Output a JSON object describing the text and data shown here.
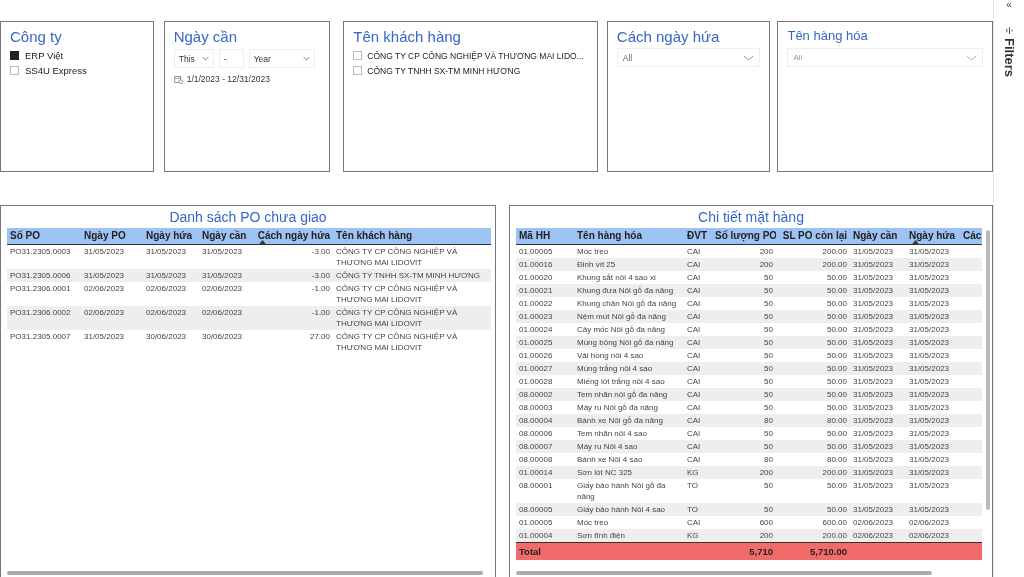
{
  "slicers": {
    "company": {
      "title": "Công ty",
      "items": [
        {
          "label": "ERP Việt",
          "selected": true
        },
        {
          "label": "SS4U Express",
          "selected": false
        }
      ]
    },
    "date": {
      "title": "Ngày cần",
      "relative": "This",
      "count": "-",
      "unit": "Year",
      "range": "1/1/2023 - 12/31/2023"
    },
    "customer": {
      "title": "Tên khách hàng",
      "items": [
        {
          "label": "CÔNG TY CP CÔNG NGHIỆP VÀ THƯƠNG MAI LIDO...",
          "checked": false
        },
        {
          "label": "CÔNG TY TNHH SX-TM MINH HƯƠNG",
          "checked": false
        }
      ]
    },
    "promise_gap": {
      "title": "Cách ngày hứa",
      "dropdown": "All"
    },
    "product": {
      "title": "Tên hàng hóa",
      "dropdown": "All"
    }
  },
  "po_table": {
    "title": "Danh sách PO chưa giao",
    "columns": [
      {
        "label": "Số PO",
        "sorted": false
      },
      {
        "label": "Ngày PO",
        "sorted": false
      },
      {
        "label": "Ngày hứa",
        "sorted": false
      },
      {
        "label": "Ngày cần",
        "sorted": false
      },
      {
        "label": "Cách ngày hứa",
        "sorted": true
      },
      {
        "label": "Tên khách hàng",
        "sorted": false
      }
    ],
    "rows": [
      [
        "PO31.2305.0003",
        "31/05/2023",
        "31/05/2023",
        "31/05/2023",
        "-3.00",
        "CÔNG TY CP CÔNG NGHIỆP VÀ THƯƠNG MAI LIDOVIT"
      ],
      [
        "PO31.2305.0006",
        "31/05/2023",
        "31/05/2023",
        "31/05/2023",
        "-3.00",
        "CÔNG TY TNHH SX-TM MINH HƯƠNG"
      ],
      [
        "PO31.2306.0001",
        "02/06/2023",
        "02/06/2023",
        "02/06/2023",
        "-1.00",
        "CÔNG TY CP CÔNG NGHIỆP VÀ THƯƠNG MAI LIDOVIT"
      ],
      [
        "PO31.2306.0002",
        "02/06/2023",
        "02/06/2023",
        "02/06/2023",
        "-1.00",
        "CÔNG TY CP CÔNG NGHIỆP VÀ THƯƠNG MAI LIDOVIT"
      ],
      [
        "PO31.2305.0007",
        "31/05/2023",
        "30/06/2023",
        "30/06/2023",
        "27.00",
        "CÔNG TY CP CÔNG NGHIỆP VÀ THƯƠNG MAI LIDOVIT"
      ]
    ]
  },
  "item_table": {
    "title": "Chi tiết mặt hàng",
    "columns": [
      {
        "label": "Mã HH",
        "sorted": false
      },
      {
        "label": "Tên hàng hóa",
        "sorted": false
      },
      {
        "label": "ĐVT",
        "sorted": false
      },
      {
        "label": "Số lượng PO",
        "sorted": false
      },
      {
        "label": "SL PO còn lại",
        "sorted": false
      },
      {
        "label": "Ngày cần",
        "sorted": false
      },
      {
        "label": "Ngày hứa",
        "sorted": true
      },
      {
        "label": "Các",
        "sorted": false
      }
    ],
    "rows": [
      [
        "01.00005",
        "Móc treo",
        "CAI",
        "200",
        "200.00",
        "31/05/2023",
        "31/05/2023"
      ],
      [
        "01.00016",
        "Đinh vít 25",
        "CAI",
        "200",
        "200.00",
        "31/05/2023",
        "31/05/2023"
      ],
      [
        "01.00020",
        "Khung sắt nôi 4 sao xi",
        "CAI",
        "50",
        "50.00",
        "31/05/2023",
        "31/05/2023"
      ],
      [
        "01.00021",
        "Khung đưa Nôi gỗ đa năng",
        "CAI",
        "50",
        "50.00",
        "31/05/2023",
        "31/05/2023"
      ],
      [
        "01.00022",
        "Khung chân Nôi gỗ đa năng",
        "CAI",
        "50",
        "50.00",
        "31/05/2023",
        "31/05/2023"
      ],
      [
        "01.00023",
        "Nệm mút Nôi gỗ đa năng",
        "CAI",
        "50",
        "50.00",
        "31/05/2023",
        "31/05/2023"
      ],
      [
        "01.00024",
        "Cây mốc Nôi gỗ đa năng",
        "CAI",
        "50",
        "50.00",
        "31/05/2023",
        "31/05/2023"
      ],
      [
        "01.00025",
        "Mùng bông Nôi gỗ đa năng",
        "CAI",
        "50",
        "50.00",
        "31/05/2023",
        "31/05/2023"
      ],
      [
        "01.00026",
        "Vải hồng nôi 4 sao",
        "CAI",
        "50",
        "50.00",
        "31/05/2023",
        "31/05/2023"
      ],
      [
        "01.00027",
        "Mùng trắng nôi 4 sao",
        "CAI",
        "50",
        "50.00",
        "31/05/2023",
        "31/05/2023"
      ],
      [
        "01.00028",
        "Miếng lót trắng nôi 4 sao",
        "CAI",
        "50",
        "50.00",
        "31/05/2023",
        "31/05/2023"
      ],
      [
        "08.00002",
        "Tem nhãn nôi gỗ đa năng",
        "CAI",
        "50",
        "50.00",
        "31/05/2023",
        "31/05/2023"
      ],
      [
        "08.00003",
        "Máy ru Nôi gỗ đa năng",
        "CAI",
        "50",
        "50.00",
        "31/05/2023",
        "31/05/2023"
      ],
      [
        "08.00004",
        "Bánh xe Nôi gỗ đa năng",
        "CAI",
        "80",
        "80.00",
        "31/05/2023",
        "31/05/2023"
      ],
      [
        "08.00006",
        "Tem nhãn nôi 4 sao",
        "CAI",
        "50",
        "50.00",
        "31/05/2023",
        "31/05/2023"
      ],
      [
        "08.00007",
        "Máy ru Nôi 4 sao",
        "CAI",
        "50",
        "50.00",
        "31/05/2023",
        "31/05/2023"
      ],
      [
        "08.00008",
        "Bánh xe Nôi 4 sao",
        "CAI",
        "80",
        "80.00",
        "31/05/2023",
        "31/05/2023"
      ],
      [
        "01.00014",
        "Sơn lót NC 325",
        "KG",
        "200",
        "200.00",
        "31/05/2023",
        "31/05/2023"
      ],
      [
        "08.00001",
        "Giấy bảo hành Nôi gỗ đa năng",
        "TO",
        "50",
        "50.00",
        "31/05/2023",
        "31/05/2023"
      ],
      [
        "08.00005",
        "Giấy bảo hành Nôi 4 sao",
        "TO",
        "50",
        "50.00",
        "31/05/2023",
        "31/05/2023"
      ],
      [
        "01.00005",
        "Móc treo",
        "CAI",
        "600",
        "600.00",
        "02/06/2023",
        "02/06/2023"
      ],
      [
        "01.00004",
        "Sơn tĩnh điện",
        "KG",
        "200",
        "200.00",
        "02/06/2023",
        "02/06/2023"
      ]
    ],
    "total": {
      "label": "Total",
      "quantity": "5,710",
      "remaining": "5,710.00"
    }
  },
  "filters_pane": {
    "collapse": "«",
    "label": "Filters"
  }
}
